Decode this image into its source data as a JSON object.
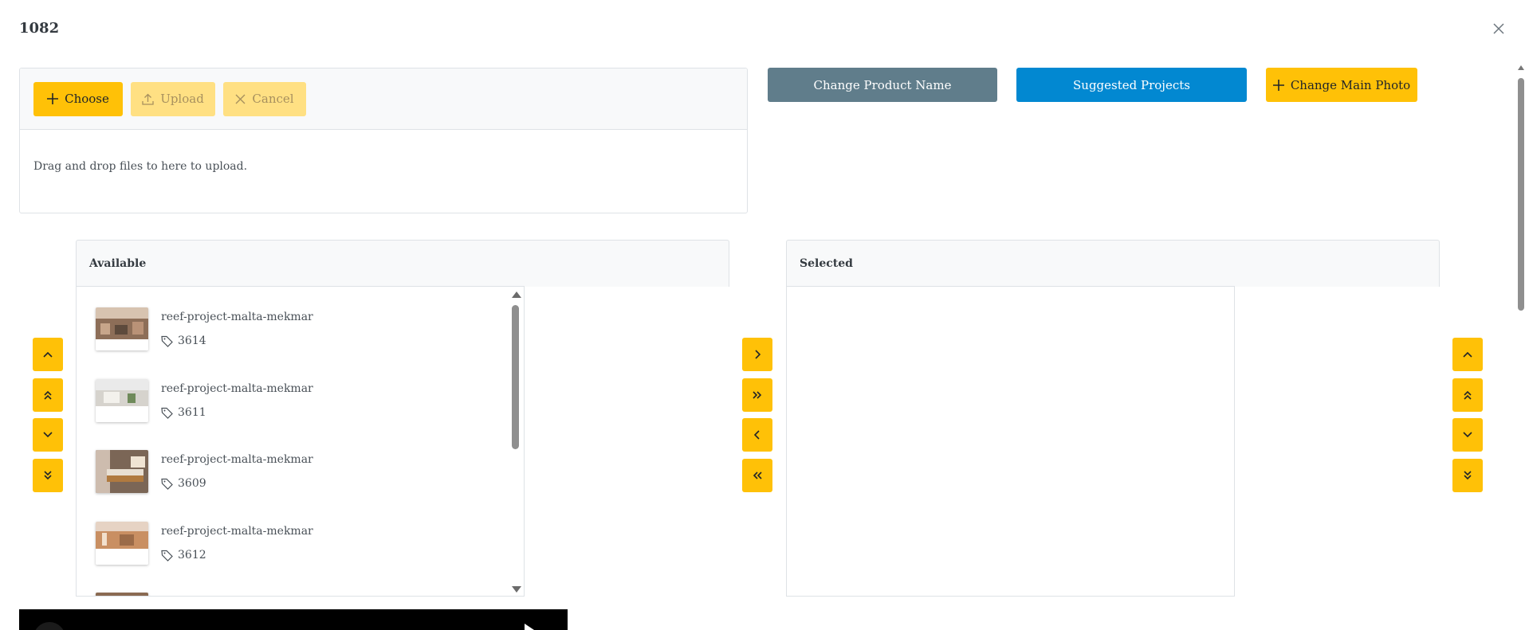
{
  "dialog": {
    "title": "1082"
  },
  "upload": {
    "choose_label": "Choose",
    "upload_label": "Upload",
    "cancel_label": "Cancel",
    "drop_message": "Drag and drop files to here to upload."
  },
  "actions": {
    "change_name_label": "Change Product Name",
    "suggested_projects_label": "Suggested Projects",
    "change_photo_label": "Change Main Photo"
  },
  "picklist": {
    "available_header": "Available",
    "selected_header": "Selected",
    "items": [
      {
        "name": "reef-project-malta-mekmar",
        "id": "3614"
      },
      {
        "name": "reef-project-malta-mekmar",
        "id": "3611"
      },
      {
        "name": "reef-project-malta-mekmar",
        "id": "3609"
      },
      {
        "name": "reef-project-malta-mekmar",
        "id": "3612"
      }
    ]
  },
  "colors": {
    "primary_yellow": "#ffc107",
    "disabled_yellow": "#ffe083",
    "secondary_gray": "#607d8b",
    "info_blue": "#0288d1"
  }
}
